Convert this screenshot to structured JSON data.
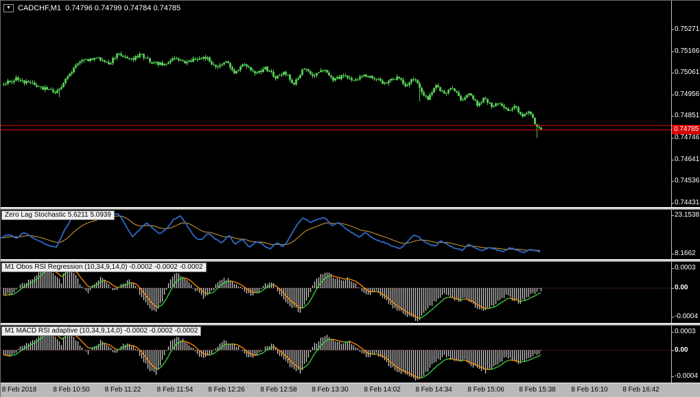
{
  "window": {
    "title": "CADCHF,M1"
  },
  "header": {
    "collapse_icon": "▼",
    "symbol": "CADCHF,M1",
    "ohlc": "0.74796 0.74799 0.74784 0.74785"
  },
  "colors": {
    "chart_bg": "#000000",
    "axis_text": "#ffffff",
    "candle": "#55c855",
    "red_line": "#e01010",
    "price_box_bg": "#d40000",
    "stoch_main": "#2d6bc8",
    "stoch_signal": "#d8a23a",
    "hist_bar": "#cccccc",
    "env_up": "#3ecb3e",
    "env_down": "#ff8a00",
    "zero_dots": "#b05050",
    "scale_strip": "#b9b9b9",
    "separator": "#d4d0c8"
  },
  "price_axis": {
    "labels": [
      "0.75271",
      "0.75166",
      "0.75061",
      "0.74956",
      "0.74851",
      "0.74746",
      "0.74641",
      "0.74536",
      "0.74431"
    ],
    "current": "0.74785"
  },
  "time_axis": {
    "labels": [
      "8 Feb 2018",
      "8 Feb 10:50",
      "8 Feb 11:22",
      "8 Feb 11:54",
      "8 Feb 12:26",
      "8 Feb 12:58",
      "8 Feb 13:30",
      "8 Feb 14:02",
      "8 Feb 14:34",
      "8 Feb 15:06",
      "8 Feb 15:38",
      "8 Feb 16:10",
      "8 Feb 16:42"
    ]
  },
  "indicators": [
    {
      "id": "stoch",
      "label": "Zero Lag Stochastic 5.6211 5.0939",
      "scale_labels": [
        "23.1538",
        "8.1662"
      ]
    },
    {
      "id": "rsi",
      "label": "M1 Obos RSI Regression (10,34,9,14,0) -0.0002 -0.0002 -0.0002",
      "scale_labels": [
        "0.0003",
        "0.00",
        "-0.0004"
      ]
    },
    {
      "id": "macd",
      "label": "M1 MACD RSI adaptive (10,34,9,14,0) -0.0002 -0.0002 -0.0002",
      "scale_labels": [
        "0.0003",
        "0.00",
        "-0.0004"
      ]
    }
  ],
  "chart_data": [
    {
      "type": "candlestick",
      "title": "CADCHF,M1",
      "ylabel": "price",
      "ylim": [
        0.744,
        0.7542
      ],
      "current_ohlc": [
        0.74796,
        0.74799,
        0.74784,
        0.74785
      ],
      "red_lines": [
        0.74806,
        0.74785
      ],
      "close_anchors": [
        [
          0,
          0.75
        ],
        [
          22,
          0.7503
        ],
        [
          50,
          0.75
        ],
        [
          80,
          0.74965
        ],
        [
          95,
          0.7503
        ],
        [
          112,
          0.7511
        ],
        [
          138,
          0.75135
        ],
        [
          158,
          0.75105
        ],
        [
          172,
          0.7516
        ],
        [
          188,
          0.7512
        ],
        [
          204,
          0.7515
        ],
        [
          220,
          0.75115
        ],
        [
          236,
          0.751
        ],
        [
          252,
          0.7514
        ],
        [
          268,
          0.75105
        ],
        [
          282,
          0.75125
        ],
        [
          296,
          0.75145
        ],
        [
          312,
          0.75085
        ],
        [
          326,
          0.7512
        ],
        [
          340,
          0.75065
        ],
        [
          356,
          0.75105
        ],
        [
          370,
          0.75055
        ],
        [
          386,
          0.75085
        ],
        [
          400,
          0.75035
        ],
        [
          414,
          0.75065
        ],
        [
          426,
          0.75005
        ],
        [
          440,
          0.7508
        ],
        [
          456,
          0.75045
        ],
        [
          470,
          0.75075
        ],
        [
          486,
          0.75025
        ],
        [
          500,
          0.75055
        ],
        [
          516,
          0.75025
        ],
        [
          530,
          0.7505
        ],
        [
          546,
          0.7503
        ],
        [
          560,
          0.7501
        ],
        [
          576,
          0.7504
        ],
        [
          590,
          0.75
        ],
        [
          600,
          0.7504
        ],
        [
          612,
          0.74975
        ],
        [
          622,
          0.74935
        ],
        [
          634,
          0.75
        ],
        [
          646,
          0.7496
        ],
        [
          658,
          0.7499
        ],
        [
          670,
          0.7493
        ],
        [
          682,
          0.7496
        ],
        [
          694,
          0.7491
        ],
        [
          706,
          0.7494
        ],
        [
          716,
          0.7489
        ],
        [
          726,
          0.7492
        ],
        [
          738,
          0.7487
        ],
        [
          748,
          0.749
        ],
        [
          760,
          0.74845
        ],
        [
          770,
          0.7487
        ],
        [
          780,
          0.748
        ],
        [
          787,
          0.74785
        ]
      ]
    },
    {
      "type": "line",
      "title": "Zero Lag Stochastic",
      "values": [
        5.6211,
        5.0939
      ],
      "ylim": [
        0,
        100
      ],
      "anchors": [
        [
          0,
          40
        ],
        [
          12,
          48
        ],
        [
          22,
          38
        ],
        [
          34,
          52
        ],
        [
          46,
          42
        ],
        [
          58,
          30
        ],
        [
          70,
          22
        ],
        [
          82,
          18
        ],
        [
          92,
          55
        ],
        [
          104,
          88
        ],
        [
          118,
          96
        ],
        [
          132,
          90
        ],
        [
          146,
          97
        ],
        [
          160,
          95
        ],
        [
          172,
          97
        ],
        [
          182,
          70
        ],
        [
          192,
          42
        ],
        [
          202,
          58
        ],
        [
          212,
          76
        ],
        [
          222,
          62
        ],
        [
          232,
          50
        ],
        [
          242,
          62
        ],
        [
          252,
          84
        ],
        [
          262,
          92
        ],
        [
          272,
          68
        ],
        [
          282,
          42
        ],
        [
          292,
          34
        ],
        [
          302,
          52
        ],
        [
          312,
          38
        ],
        [
          322,
          28
        ],
        [
          332,
          46
        ],
        [
          342,
          24
        ],
        [
          352,
          36
        ],
        [
          362,
          18
        ],
        [
          372,
          30
        ],
        [
          382,
          24
        ],
        [
          392,
          12
        ],
        [
          402,
          28
        ],
        [
          412,
          18
        ],
        [
          422,
          42
        ],
        [
          432,
          72
        ],
        [
          442,
          88
        ],
        [
          452,
          76
        ],
        [
          462,
          84
        ],
        [
          472,
          88
        ],
        [
          482,
          68
        ],
        [
          492,
          76
        ],
        [
          502,
          62
        ],
        [
          512,
          52
        ],
        [
          522,
          42
        ],
        [
          532,
          52
        ],
        [
          542,
          38
        ],
        [
          552,
          32
        ],
        [
          562,
          26
        ],
        [
          572,
          20
        ],
        [
          582,
          14
        ],
        [
          592,
          28
        ],
        [
          602,
          48
        ],
        [
          612,
          38
        ],
        [
          622,
          26
        ],
        [
          632,
          20
        ],
        [
          642,
          32
        ],
        [
          652,
          22
        ],
        [
          662,
          14
        ],
        [
          672,
          10
        ],
        [
          682,
          24
        ],
        [
          692,
          14
        ],
        [
          702,
          8
        ],
        [
          712,
          18
        ],
        [
          722,
          12
        ],
        [
          732,
          6
        ],
        [
          742,
          16
        ],
        [
          752,
          10
        ],
        [
          762,
          5
        ],
        [
          772,
          12
        ],
        [
          787,
          6
        ]
      ]
    },
    {
      "type": "bar",
      "title": "M1 Obos RSI Regression (10,34,9,14,0)",
      "values": [
        -0.0002,
        -0.0002,
        -0.0002
      ],
      "ylim": [
        -0.0004,
        0.0003
      ],
      "unit": "1e-4",
      "anchors_e4": [
        [
          0,
          -0.5
        ],
        [
          14,
          -0.9
        ],
        [
          28,
          0.4
        ],
        [
          44,
          1.0
        ],
        [
          58,
          2.0
        ],
        [
          68,
          2.9
        ],
        [
          78,
          1.6
        ],
        [
          88,
          0.7
        ],
        [
          96,
          2.9
        ],
        [
          106,
          1.7
        ],
        [
          116,
          0.5
        ],
        [
          126,
          -0.5
        ],
        [
          136,
          0.5
        ],
        [
          146,
          1.2
        ],
        [
          156,
          0.6
        ],
        [
          166,
          -0.4
        ],
        [
          176,
          0.5
        ],
        [
          186,
          0.9
        ],
        [
          196,
          0.2
        ],
        [
          206,
          -1.2
        ],
        [
          216,
          -2.4
        ],
        [
          226,
          -2.9
        ],
        [
          236,
          -1.2
        ],
        [
          246,
          0.9
        ],
        [
          256,
          1.7
        ],
        [
          266,
          1.2
        ],
        [
          276,
          0.6
        ],
        [
          286,
          -0.5
        ],
        [
          296,
          -1.1
        ],
        [
          306,
          -0.6
        ],
        [
          316,
          0.6
        ],
        [
          326,
          1.1
        ],
        [
          336,
          0.8
        ],
        [
          346,
          0.3
        ],
        [
          356,
          -0.6
        ],
        [
          366,
          -1.0
        ],
        [
          376,
          -0.4
        ],
        [
          386,
          0.5
        ],
        [
          396,
          0.7
        ],
        [
          406,
          -0.7
        ],
        [
          416,
          -1.5
        ],
        [
          426,
          -2.3
        ],
        [
          436,
          -2.7
        ],
        [
          446,
          -1.4
        ],
        [
          456,
          0.6
        ],
        [
          466,
          1.5
        ],
        [
          476,
          1.9
        ],
        [
          486,
          1.2
        ],
        [
          496,
          0.8
        ],
        [
          506,
          1.1
        ],
        [
          516,
          0.5
        ],
        [
          526,
          -0.4
        ],
        [
          536,
          -0.8
        ],
        [
          546,
          -0.4
        ],
        [
          556,
          -1.1
        ],
        [
          566,
          -1.9
        ],
        [
          576,
          -2.5
        ],
        [
          586,
          -2.9
        ],
        [
          596,
          -3.3
        ],
        [
          606,
          -3.8
        ],
        [
          616,
          -3.0
        ],
        [
          626,
          -2.1
        ],
        [
          636,
          -1.3
        ],
        [
          646,
          -0.7
        ],
        [
          656,
          -1.1
        ],
        [
          666,
          -1.6
        ],
        [
          676,
          -1.1
        ],
        [
          686,
          -1.9
        ],
        [
          696,
          -2.3
        ],
        [
          706,
          -2.7
        ],
        [
          716,
          -2.1
        ],
        [
          726,
          -1.5
        ],
        [
          736,
          -0.9
        ],
        [
          746,
          -1.3
        ],
        [
          756,
          -1.7
        ],
        [
          766,
          -1.1
        ],
        [
          776,
          -0.6
        ],
        [
          787,
          -0.2
        ]
      ]
    },
    {
      "type": "bar",
      "title": "M1 MACD RSI adaptive (10,34,9,14,0)",
      "values": [
        -0.0002,
        -0.0002,
        -0.0002
      ],
      "ylim": [
        -0.0004,
        0.0003
      ],
      "unit": "1e-4",
      "anchors_e4": [
        [
          0,
          -0.5
        ],
        [
          14,
          -0.9
        ],
        [
          28,
          0.4
        ],
        [
          44,
          1.0
        ],
        [
          58,
          2.0
        ],
        [
          68,
          2.9
        ],
        [
          78,
          1.6
        ],
        [
          88,
          0.7
        ],
        [
          96,
          2.9
        ],
        [
          106,
          1.7
        ],
        [
          116,
          0.5
        ],
        [
          126,
          -0.5
        ],
        [
          136,
          0.5
        ],
        [
          146,
          1.2
        ],
        [
          156,
          0.6
        ],
        [
          166,
          -0.4
        ],
        [
          176,
          0.5
        ],
        [
          186,
          0.9
        ],
        [
          196,
          0.2
        ],
        [
          206,
          -1.2
        ],
        [
          216,
          -2.4
        ],
        [
          226,
          -2.9
        ],
        [
          236,
          -1.2
        ],
        [
          246,
          0.9
        ],
        [
          256,
          1.7
        ],
        [
          266,
          1.2
        ],
        [
          276,
          0.6
        ],
        [
          286,
          -0.5
        ],
        [
          296,
          -1.1
        ],
        [
          306,
          -0.6
        ],
        [
          316,
          0.6
        ],
        [
          326,
          1.1
        ],
        [
          336,
          0.8
        ],
        [
          346,
          0.3
        ],
        [
          356,
          -0.6
        ],
        [
          366,
          -1.0
        ],
        [
          376,
          -0.4
        ],
        [
          386,
          0.5
        ],
        [
          396,
          0.7
        ],
        [
          406,
          -0.7
        ],
        [
          416,
          -1.5
        ],
        [
          426,
          -2.3
        ],
        [
          436,
          -2.7
        ],
        [
          446,
          -1.4
        ],
        [
          456,
          0.6
        ],
        [
          466,
          1.5
        ],
        [
          476,
          1.9
        ],
        [
          486,
          1.2
        ],
        [
          496,
          0.8
        ],
        [
          506,
          1.1
        ],
        [
          516,
          0.5
        ],
        [
          526,
          -0.4
        ],
        [
          536,
          -0.8
        ],
        [
          546,
          -0.4
        ],
        [
          556,
          -1.1
        ],
        [
          566,
          -1.9
        ],
        [
          576,
          -2.5
        ],
        [
          586,
          -2.9
        ],
        [
          596,
          -3.3
        ],
        [
          606,
          -3.8
        ],
        [
          616,
          -3.0
        ],
        [
          626,
          -2.1
        ],
        [
          636,
          -1.3
        ],
        [
          646,
          -0.7
        ],
        [
          656,
          -1.1
        ],
        [
          666,
          -1.6
        ],
        [
          676,
          -1.1
        ],
        [
          686,
          -1.9
        ],
        [
          696,
          -2.3
        ],
        [
          706,
          -2.7
        ],
        [
          716,
          -2.1
        ],
        [
          726,
          -1.5
        ],
        [
          736,
          -0.9
        ],
        [
          746,
          -1.3
        ],
        [
          756,
          -1.7
        ],
        [
          766,
          -1.1
        ],
        [
          776,
          -0.6
        ],
        [
          787,
          -0.2
        ]
      ]
    }
  ]
}
